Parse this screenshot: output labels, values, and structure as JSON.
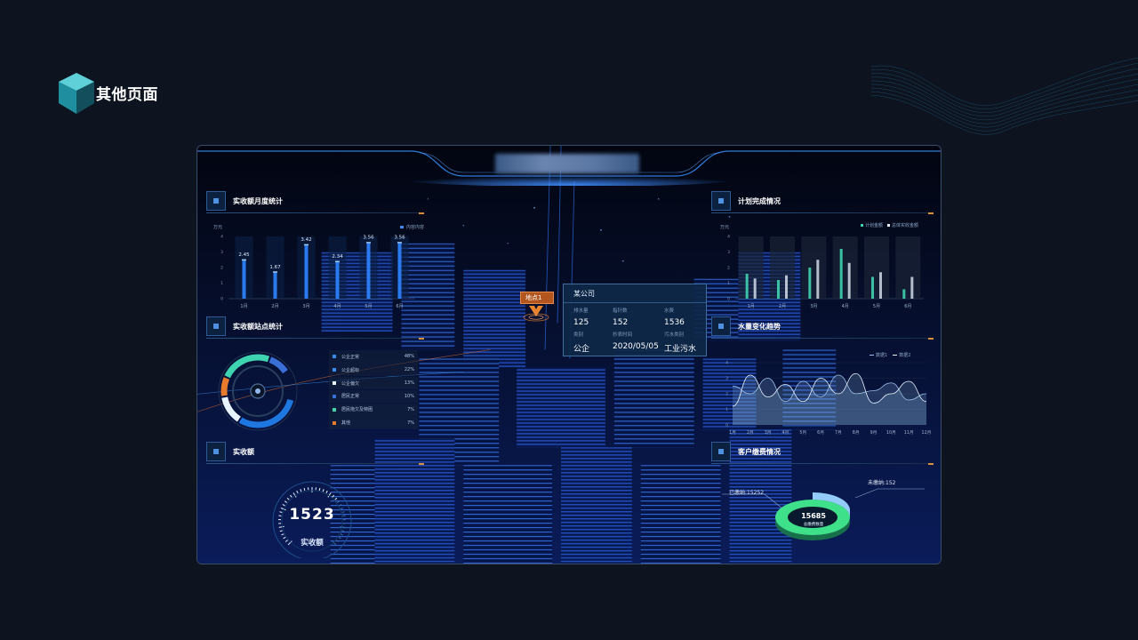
{
  "page": {
    "title": "其他页面"
  },
  "tooltip": {
    "marker_label": "地点1",
    "company": "某公司",
    "fields": [
      {
        "key": "排水量",
        "value": "125"
      },
      {
        "key": "指针数",
        "value": "152"
      },
      {
        "key": "水费",
        "value": "1536"
      },
      {
        "key": "类别",
        "value": "公企"
      },
      {
        "key": "抄表时间",
        "value": "2020/05/05"
      },
      {
        "key": "污水类别",
        "value": "工业污水"
      }
    ]
  },
  "panels": {
    "monthly": {
      "title": "实收额月度统计",
      "unit": "万元",
      "legend": "内容内容",
      "chart_data": {
        "type": "bar",
        "categories": [
          "1月",
          "2月",
          "3月",
          "4月",
          "5月",
          "6月"
        ],
        "values": [
          2.45,
          1.67,
          3.42,
          2.34,
          3.56,
          3.56
        ],
        "value_labels": [
          "2.45",
          "1.67",
          "3.42",
          "2.34",
          "3.56",
          "3.56"
        ],
        "ylim": [
          0,
          4
        ],
        "yticks": [
          "0",
          "1",
          "2",
          "3",
          "4"
        ]
      }
    },
    "stations": {
      "title": "实收额站点统计",
      "items": [
        {
          "name": "公企正常",
          "value": "48%",
          "color": "#3a8be8"
        },
        {
          "name": "公企超标",
          "value": "22%",
          "color": "#3a8be8"
        },
        {
          "name": "公企偏欠",
          "value": "13%",
          "color": "#e8f4ff"
        },
        {
          "name": "居民正常",
          "value": "10%",
          "color": "#3a6fd8"
        },
        {
          "name": "居民拖欠及特困",
          "value": "7%",
          "color": "#3fd4b0"
        },
        {
          "name": "其他",
          "value": "7%",
          "color": "#e87a2e"
        }
      ]
    },
    "received": {
      "title": "实收额",
      "value": "1523",
      "caption": "实收额"
    },
    "plan": {
      "title": "计划完成情况",
      "unit": "万元",
      "legend": [
        "计划金额",
        "总体实收金额"
      ],
      "chart_data": {
        "type": "bar",
        "categories": [
          "1月",
          "2月",
          "3月",
          "4月",
          "5月",
          "6月"
        ],
        "series": [
          {
            "name": "计划金额",
            "values": [
              1.6,
              1.2,
              2.0,
              3.2,
              1.4,
              0.6
            ]
          },
          {
            "name": "总体实收金额",
            "values": [
              1.3,
              1.5,
              2.5,
              2.3,
              1.7,
              1.4
            ]
          }
        ],
        "ylim": [
          0,
          4
        ],
        "yticks": [
          "0",
          "1",
          "2",
          "3",
          "4"
        ]
      }
    },
    "water": {
      "title": "水量变化趋势",
      "legend": [
        "数据1",
        "数据2"
      ],
      "chart_data": {
        "type": "area",
        "categories": [
          "1月",
          "2月",
          "3月",
          "4月",
          "5月",
          "6月",
          "7月",
          "8月",
          "9月",
          "10月",
          "11月",
          "12月"
        ],
        "series": [
          {
            "name": "数据1",
            "values": [
              2.5,
              2.0,
              3.0,
              1.5,
              2.8,
              1.8,
              3.2,
              2.0,
              2.2,
              2.7,
              1.6,
              2.0
            ]
          },
          {
            "name": "数据2",
            "values": [
              1.2,
              3.2,
              1.8,
              2.6,
              1.5,
              3.0,
              2.0,
              3.3,
              1.4,
              2.0,
              2.8,
              1.5
            ]
          }
        ],
        "ylim": [
          0,
          4
        ],
        "yticks": [
          "0",
          "1",
          "2",
          "3",
          "4"
        ]
      }
    },
    "customer": {
      "title": "客户缴费情况",
      "paid_label": "已缴纳:15252",
      "unpaid_label": "未缴纳:152",
      "total_value": "15685",
      "total_caption": "总缴费数量"
    }
  }
}
